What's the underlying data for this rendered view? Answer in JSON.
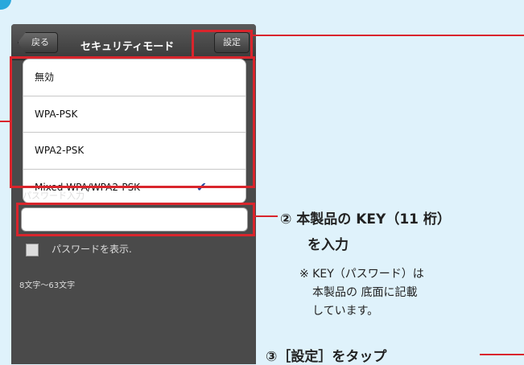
{
  "navbar": {
    "back_label": "戻る",
    "title": "セキュリティモード",
    "settings_label": "設定"
  },
  "security_options": [
    {
      "label": "無効",
      "selected": false
    },
    {
      "label": "WPA-PSK",
      "selected": false
    },
    {
      "label": "WPA2-PSK",
      "selected": false
    },
    {
      "label": "Mixed WPA/WPA2-PSK",
      "selected": true
    }
  ],
  "checkmark_icon": "✔",
  "password": {
    "label": "パスワード入力",
    "value": "",
    "show_label": "パスワードを表示.",
    "length_note": "8文字〜63文字"
  },
  "annotations": {
    "step2_line1": "② 本製品の KEY（11 桁）",
    "step2_line2": "を入力",
    "note_line1": "※ KEY（パスワード）は",
    "note_line2": "本製品の 底面に記載",
    "note_line3": "しています。",
    "step3": "③［設定］をタップ"
  },
  "colors": {
    "highlight": "#d9252c",
    "background": "#dff2fb",
    "marker": "#2aa8dc"
  }
}
